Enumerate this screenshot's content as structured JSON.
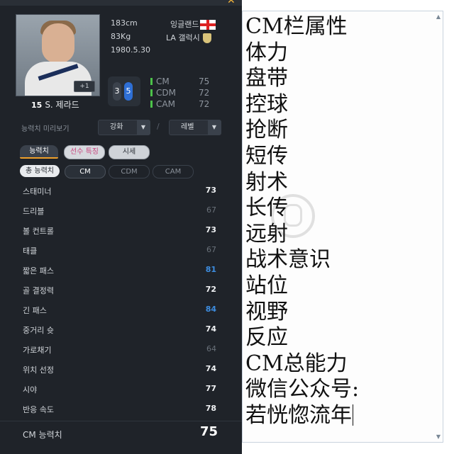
{
  "player": {
    "number": "15",
    "name": "S. 제라드",
    "height": "183cm",
    "weight": "83Kg",
    "birth": "1980.5.30",
    "nation": "잉글랜드",
    "club": "LA 갤럭시",
    "plus_badge": "+1",
    "foot_left": "3",
    "foot_right": "5"
  },
  "positions": [
    {
      "pos": "CM",
      "value": "75"
    },
    {
      "pos": "CDM",
      "value": "72"
    },
    {
      "pos": "CAM",
      "value": "72"
    }
  ],
  "preview": {
    "label": "능력치 미리보기",
    "enhance": "강화",
    "slash": "/",
    "level": "레벨"
  },
  "tabs": [
    "능력치",
    "선수 특징",
    "시세"
  ],
  "subtabs": [
    "총 능력치",
    "CM",
    "CDM",
    "CAM"
  ],
  "stats": [
    {
      "label": "스태미너",
      "value": "73",
      "tone": "white"
    },
    {
      "label": "드리블",
      "value": "67",
      "tone": "gray"
    },
    {
      "label": "볼 컨트롤",
      "value": "73",
      "tone": "white"
    },
    {
      "label": "태클",
      "value": "67",
      "tone": "gray"
    },
    {
      "label": "짧은 패스",
      "value": "81",
      "tone": "blue"
    },
    {
      "label": "골 결정력",
      "value": "72",
      "tone": "white"
    },
    {
      "label": "긴 패스",
      "value": "84",
      "tone": "blue"
    },
    {
      "label": "중거리 슛",
      "value": "74",
      "tone": "white"
    },
    {
      "label": "가로채기",
      "value": "64",
      "tone": "gray"
    },
    {
      "label": "위치 선정",
      "value": "74",
      "tone": "white"
    },
    {
      "label": "시야",
      "value": "77",
      "tone": "white"
    },
    {
      "label": "반응 속도",
      "value": "78",
      "tone": "white"
    }
  ],
  "total": {
    "label": "CM 능력치",
    "value": "75"
  },
  "editor": {
    "lines": [
      "CM栏属性",
      "体力",
      "盘带",
      "控球",
      "抢断",
      "短传",
      "射术",
      "长传",
      "远射",
      "战术意识",
      "站位",
      "视野",
      "反应",
      "CM总能力",
      "微信公众号:",
      "若恍惚流年"
    ]
  },
  "colors": {
    "blue_value": "#3d8de0",
    "accent_tab": "#f0a12a",
    "position_bar": "#4cc24a"
  }
}
